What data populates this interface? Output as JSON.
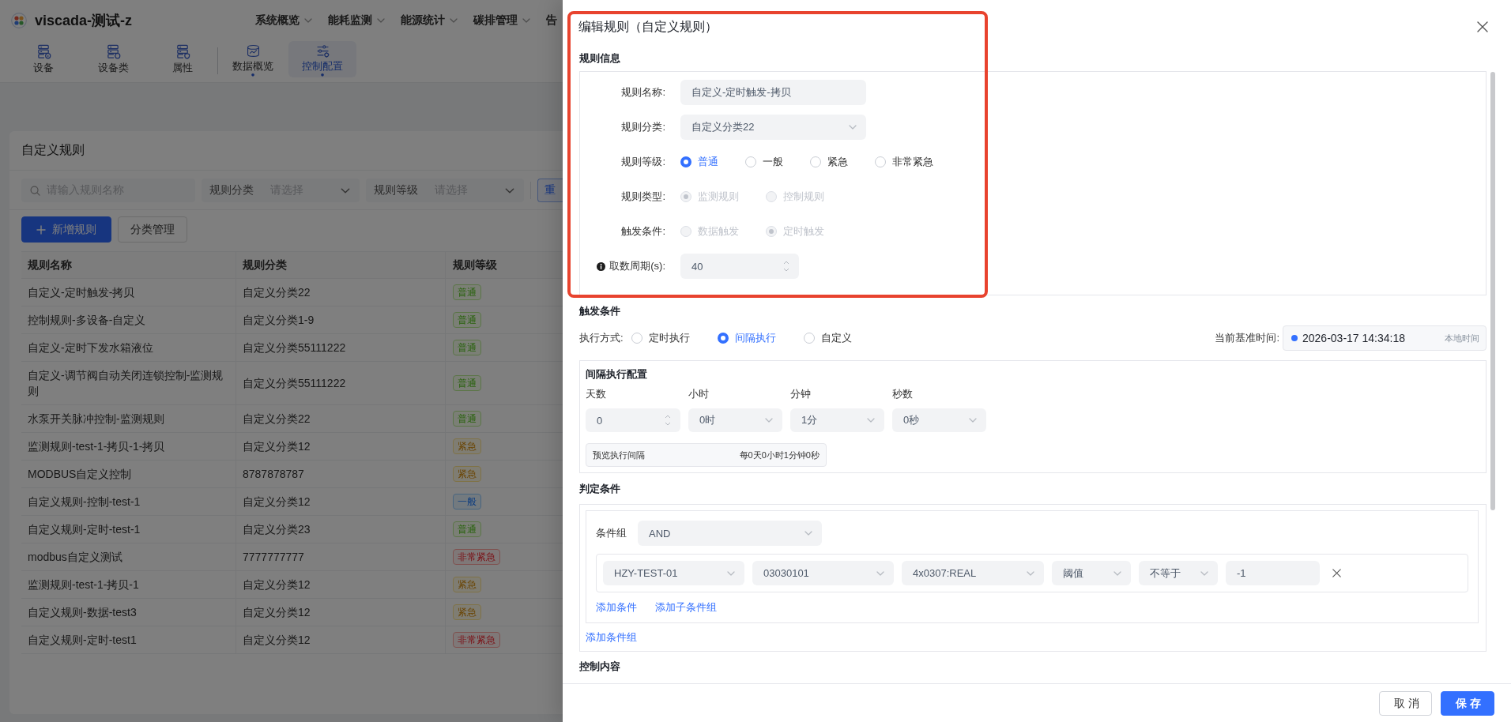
{
  "header": {
    "title": "viscada-测试-z",
    "nav": [
      {
        "label": "系统概览",
        "caret": true
      },
      {
        "label": "能耗监测",
        "caret": true
      },
      {
        "label": "能源统计",
        "caret": true
      },
      {
        "label": "碳排管理",
        "caret": true
      },
      {
        "label": "告",
        "caret": false
      }
    ],
    "toolbar": [
      {
        "items": [
          {
            "label": "设备",
            "selected": false,
            "dot": false
          },
          {
            "label": "设备类",
            "selected": false,
            "dot": false
          },
          {
            "label": "属性",
            "selected": false,
            "dot": false
          }
        ]
      },
      {
        "items": [
          {
            "label": "数据概览",
            "selected": false,
            "dot": true
          },
          {
            "label": "控制配置",
            "selected": true,
            "dot": true
          }
        ]
      }
    ]
  },
  "rules": {
    "title": "自定义规则",
    "search": {
      "placeholder": "请输入规则名称"
    },
    "filters": [
      {
        "label": "规则分类",
        "placeholder": "请选择"
      },
      {
        "label": "规则等级",
        "placeholder": "请选择"
      }
    ],
    "filter_button": "重",
    "actions": [
      {
        "label": "新增规则",
        "kind": "primary"
      },
      {
        "label": "分类管理",
        "kind": "default"
      }
    ],
    "table": {
      "columns": [
        "规则名称",
        "规则分类",
        "规则等级"
      ],
      "rows": [
        {
          "cells": [
            "自定义-定时触发-拷贝",
            "自定义分类22"
          ],
          "tag": "普通",
          "kind": "normal"
        },
        {
          "cells": [
            "控制规则-多设备-自定义",
            "自定义分类1-9"
          ],
          "tag": "普通",
          "kind": "normal"
        },
        {
          "cells": [
            "自定义-定时下发水箱液位",
            "自定义分类55111222"
          ],
          "tag": "普通",
          "kind": "normal"
        },
        {
          "cells": [
            "自定义-调节阀自动关闭连锁控制-监测规则",
            "自定义分类55111222"
          ],
          "tag": "普通",
          "kind": "normal"
        },
        {
          "cells": [
            "水泵开关脉冲控制-监测规则",
            "自定义分类22"
          ],
          "tag": "普通",
          "kind": "normal"
        },
        {
          "cells": [
            "监测规则-test-1-拷贝-1-拷贝",
            "自定义分类12"
          ],
          "tag": "紧急",
          "kind": "urgent"
        },
        {
          "cells": [
            "MODBUS自定义控制",
            "8787878787"
          ],
          "tag": "紧急",
          "kind": "urgent"
        },
        {
          "cells": [
            "自定义规则-控制-test-1",
            "自定义分类12"
          ],
          "tag": "一般",
          "kind": "general"
        },
        {
          "cells": [
            "自定义规则-定时-test-1",
            "自定义分类23"
          ],
          "tag": "普通",
          "kind": "normal"
        },
        {
          "cells": [
            "modbus自定义测试",
            "7777777777"
          ],
          "tag": "非常紧急",
          "kind": "critical"
        },
        {
          "cells": [
            "监测规则-test-1-拷贝-1",
            "自定义分类12"
          ],
          "tag": "紧急",
          "kind": "urgent"
        },
        {
          "cells": [
            "自定义规则-数据-test3",
            "自定义分类12"
          ],
          "tag": "紧急",
          "kind": "urgent"
        },
        {
          "cells": [
            "自定义规则-定时-test1",
            "自定义分类12"
          ],
          "tag": "非常紧急",
          "kind": "critical"
        }
      ]
    }
  },
  "drawer": {
    "title": "编辑规则（自定义规则）",
    "highlighted": true,
    "rule_info": {
      "heading": "规则信息",
      "fields": [
        {
          "kind": "text",
          "label": "规则名称:",
          "value": "自定义-定时触发-拷贝",
          "info": false
        },
        {
          "kind": "select",
          "label": "规则分类:",
          "value": "自定义分类22",
          "info": false
        },
        {
          "kind": "radio",
          "label": "规则等级:",
          "info": false,
          "options": [
            {
              "label": "普通",
              "selected": true,
              "disabled": false
            },
            {
              "label": "一般",
              "selected": false,
              "disabled": false
            },
            {
              "label": "紧急",
              "selected": false,
              "disabled": false
            },
            {
              "label": "非常紧急",
              "selected": false,
              "disabled": false
            }
          ]
        },
        {
          "kind": "radio",
          "label": "规则类型:",
          "info": false,
          "options": [
            {
              "label": "监测规则",
              "selected": true,
              "disabled": true
            },
            {
              "label": "控制规则",
              "selected": false,
              "disabled": true
            }
          ]
        },
        {
          "kind": "radio",
          "label": "触发条件:",
          "info": false,
          "options": [
            {
              "label": "数据触发",
              "selected": false,
              "disabled": true
            },
            {
              "label": "定时触发",
              "selected": true,
              "disabled": true
            }
          ]
        },
        {
          "kind": "number",
          "label": "取数周期(s):",
          "value": "40",
          "info": true
        }
      ]
    },
    "trigger": {
      "heading": "触发条件",
      "mode_label": "执行方式:",
      "modes": [
        {
          "label": "定时执行",
          "selected": false
        },
        {
          "label": "间隔执行",
          "selected": true
        },
        {
          "label": "自定义",
          "selected": false
        }
      ],
      "base_time": {
        "label": "当前基准时间:",
        "value": "2026-03-17 14:34:18",
        "note": "本地时间"
      },
      "interval": {
        "heading": "间隔执行配置",
        "fields": [
          {
            "kind": "number",
            "label": "天数",
            "value": "0"
          },
          {
            "kind": "select",
            "label": "小时",
            "value": "0时"
          },
          {
            "kind": "select",
            "label": "分钟",
            "value": "1分"
          },
          {
            "kind": "select",
            "label": "秒数",
            "value": "0秒"
          }
        ],
        "preview": {
          "label": "预览执行间隔",
          "value": "每0天0小时1分钟0秒"
        }
      }
    },
    "judge": {
      "heading": "判定条件",
      "groups": [
        {
          "label": "条件组",
          "operator": "AND",
          "conditions": [
            {
              "fields": [
                {
                  "kind": "select",
                  "value": "HZY-TEST-01"
                },
                {
                  "kind": "select",
                  "value": "03030101"
                },
                {
                  "kind": "select",
                  "value": "4x0307:REAL"
                },
                {
                  "kind": "select",
                  "value": "阈值"
                },
                {
                  "kind": "select",
                  "value": "不等于"
                },
                {
                  "kind": "text",
                  "value": "-1"
                }
              ]
            }
          ],
          "links": [
            "添加条件",
            "添加子条件组"
          ]
        }
      ],
      "add_group": "添加条件组"
    },
    "control": {
      "heading": "控制内容"
    },
    "footer": [
      {
        "label": "取消",
        "kind": "default"
      },
      {
        "label": "保存",
        "kind": "primary"
      }
    ]
  }
}
